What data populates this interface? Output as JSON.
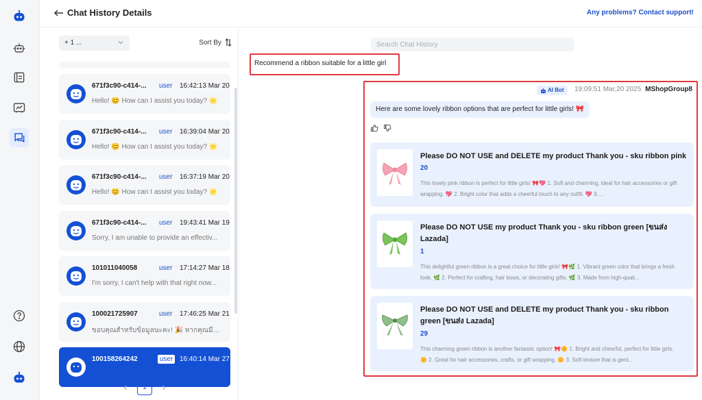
{
  "header": {
    "title": "Chat History Details",
    "support_link": "Any problems? Contact support!"
  },
  "sidebar": {
    "items": [
      {
        "icon": "bot-logo-icon"
      },
      {
        "icon": "robot-icon"
      },
      {
        "icon": "notebook-icon"
      },
      {
        "icon": "dashboard-icon"
      },
      {
        "icon": "chat-history-icon",
        "active": true
      },
      {
        "icon": "help-icon"
      },
      {
        "icon": "globe-icon"
      },
      {
        "icon": "bot-avatar-icon"
      }
    ]
  },
  "list": {
    "filter_value": "+ 1 ...",
    "sort_label": "Sort By",
    "items": [
      {
        "id": "671f3c90-c414-...",
        "role": "user",
        "time": "16:42:13 Mar 20",
        "message": "Hello! 😊 How can I assist you today? 🌟"
      },
      {
        "id": "671f3c90-c414-...",
        "role": "user",
        "time": "16:39:04 Mar 20",
        "message": "Hello! 😊 How can I assist you today? 🌟"
      },
      {
        "id": "671f3c90-c414-...",
        "role": "user",
        "time": "16:37:19 Mar 20",
        "message": "Hello! 😊 How can I assist you today? 🌟"
      },
      {
        "id": "671f3c90-c414-...",
        "role": "user",
        "time": "19:43:41 Mar 19",
        "message": "Sorry, I am unable to provide an effectiv..."
      },
      {
        "id": "101011040058",
        "role": "user",
        "time": "17:14:27 Mar 18",
        "message": "I'm sorry, I can't help with that right now..."
      },
      {
        "id": "100021725907",
        "role": "user",
        "time": "17:46:25 Mar 21",
        "message": "ขอบคุณสำหรับข้อมูลนะคะ! 🎉 หากคุณมีคำถ..."
      },
      {
        "id": "100158264242",
        "role": "user",
        "time": "16:40:14 Mar 27",
        "message": "",
        "selected": true
      }
    ],
    "current_page": "1"
  },
  "chat": {
    "search_placeholder": "Search Chat History",
    "user_message": "Recommend a ribbon suitable for a little girl",
    "bot_badge": "AI Bot",
    "bot_time": "19:09:51 Mar,20 2025",
    "bot_group": "MShopGroup8",
    "bot_reply": "Here are some lovely ribbon options that are perfect for little girls! 🎀",
    "products": [
      {
        "title": "Please DO NOT USE and DELETE my product Thank you - sku ribbon pink",
        "price": "20",
        "description": "This lovely pink ribbon is perfect for little girls! 🎀💖 1. Soft and charming, ideal for hair accessories or gift wrapping. 💖 2. Bright color that adds a cheerful touch to any outfit. 💖 3...."
      },
      {
        "title": "Please DO NOT USE my product Thank you - sku ribbon green [ขนส่ง Lazada]",
        "price": "1",
        "description": "This delightful green ribbon is a great choice for little girls! 🎀🌿 1. Vibrant green color that brings a fresh look. 🌿 2. Perfect for crafting, hair bows, or decorating gifts. 🌿 3. Made from high-quali..."
      },
      {
        "title": "Please DO NOT USE and DELETE my product Thank you - sku ribbon green [ขนส่ง Lazada]",
        "price": "29",
        "description": "This charming green ribbon is another fantastic option! 🎀🌼 1. Bright and cheerful, perfect for little girls. 🌼 2. Great for hair accessories, crafts, or gift wrapping. 🌼 3. Soft texture that is gent..."
      }
    ]
  },
  "colors": {
    "accent": "#1e50c8",
    "selected_row": "#1450d4",
    "highlight_frame": "#e0383e",
    "bubble": "#e9f1ff"
  }
}
